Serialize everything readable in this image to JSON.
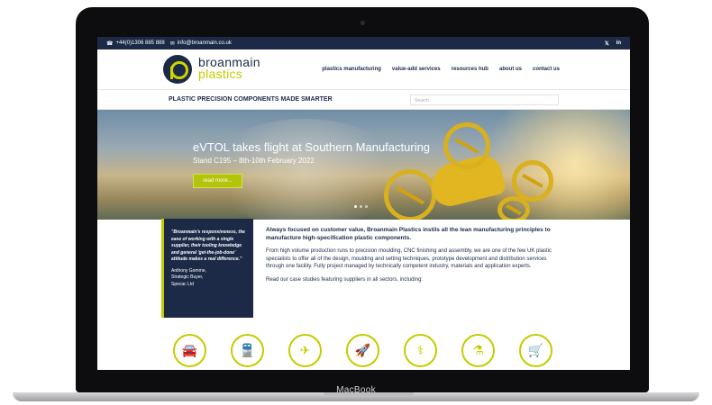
{
  "topbar": {
    "phone": "+44(0)1306 885 888",
    "email": "info@broanmain.co.uk",
    "social": [
      "twitter-icon",
      "linkedin-icon"
    ]
  },
  "logo": {
    "line1": "broanmain",
    "line2": "plastics"
  },
  "nav": [
    "plastics manufacturing",
    "value-add services",
    "resources hub",
    "about us",
    "contact us"
  ],
  "tagline": "PLASTIC PRECISION COMPONENTS MADE SMARTER",
  "search": {
    "placeholder": "Search..."
  },
  "hero": {
    "title": "eVTOL takes flight at Southern Manufacturing",
    "subtitle": "Stand C195 – 8th-10th February 2022",
    "button": "read more..."
  },
  "testimonial": {
    "quote": "\"Broanmain's responsiveness, the ease of working with a single supplier, their tooling knowledge and general 'get-the-job-done' attitude makes a real difference.\"",
    "name": "Anthony Gomme,",
    "role": "Strategic Buyer,",
    "company": "Specac Ltd"
  },
  "content": {
    "lead": "Always focused on customer value, Broanmain Plastics instils all the lean manufacturing principles to manufacture high-specification plastic components.",
    "para1": "From high volume production runs to precision moulding, CNC finishing and assembly, we are one of the few UK plastic specialists to offer all of the design, moulding and setting techniques, prototype development and distribution services through one facility. Fully project managed by technically competent industry, materials and application experts.",
    "para2": "Read our case studies featuring suppliers in all sectors, including:"
  },
  "sectors": [
    {
      "name": "car-icon",
      "glyph": "🚘"
    },
    {
      "name": "rail-icon",
      "glyph": "🚆"
    },
    {
      "name": "aircraft-icon",
      "glyph": "✈"
    },
    {
      "name": "rocket-icon",
      "glyph": "🚀"
    },
    {
      "name": "medical-icon",
      "glyph": "⚕"
    },
    {
      "name": "laboratory-icon",
      "glyph": "⚗"
    },
    {
      "name": "retail-basket-icon",
      "glyph": "🛒"
    }
  ],
  "device": {
    "label": "MacBook"
  },
  "colors": {
    "navy": "#1c2a47",
    "lime": "#c4cc00"
  }
}
